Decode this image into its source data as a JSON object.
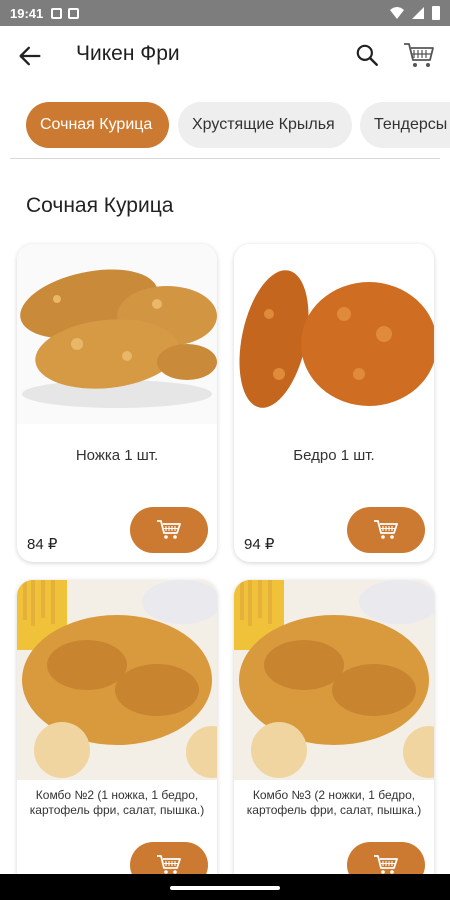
{
  "status": {
    "time": "19:41"
  },
  "header": {
    "title": "Чикен Фри"
  },
  "categories": [
    {
      "label": "Сочная Курица",
      "active": true
    },
    {
      "label": "Хрустящие Крылья",
      "active": false
    },
    {
      "label": "Тендерсы",
      "active": false
    }
  ],
  "section": {
    "title": "Сочная Курица"
  },
  "products": [
    {
      "name": "Ножка 1 шт.",
      "price": "84 ₽"
    },
    {
      "name": "Бедро 1 шт.",
      "price": "94 ₽"
    },
    {
      "name": "Комбо №2 (1 ножка, 1 бедро, картофель фри, салат, пышка.)",
      "price": ""
    },
    {
      "name": "Комбо №3 (2 ножки, 1 бедро, картофель фри, салат, пышка.)",
      "price": ""
    }
  ],
  "colors": {
    "accent": "#cc7a31",
    "chip_inactive": "#eeeeee"
  },
  "icons": {
    "back": "arrow-left-icon",
    "search": "search-icon",
    "cart": "cart-icon",
    "add_to_cart": "cart-add-icon"
  }
}
